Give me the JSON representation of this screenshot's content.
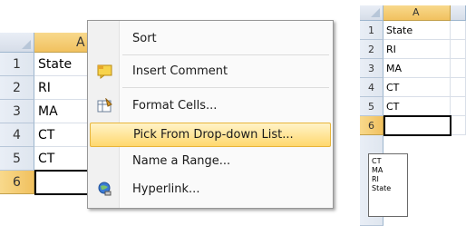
{
  "left_sheet": {
    "column": "A",
    "rows": [
      {
        "num": "1",
        "value": "State"
      },
      {
        "num": "2",
        "value": "RI"
      },
      {
        "num": "3",
        "value": "MA"
      },
      {
        "num": "4",
        "value": "CT"
      },
      {
        "num": "5",
        "value": "CT"
      },
      {
        "num": "6",
        "value": ""
      }
    ]
  },
  "context_menu": {
    "items": [
      {
        "label": "Sort",
        "icon": "none"
      },
      {
        "label": "Insert Comment",
        "icon": "comment-icon"
      },
      {
        "label": "Format Cells...",
        "icon": "format-cells-icon"
      },
      {
        "label": "Pick From Drop-down List...",
        "icon": "none",
        "highlighted": true
      },
      {
        "label": "Name a Range...",
        "icon": "none"
      },
      {
        "label": "Hyperlink...",
        "icon": "hyperlink-icon"
      }
    ]
  },
  "right_sheet": {
    "column": "A",
    "rows": [
      {
        "num": "1",
        "value": "State"
      },
      {
        "num": "2",
        "value": "RI"
      },
      {
        "num": "3",
        "value": "MA"
      },
      {
        "num": "4",
        "value": "CT"
      },
      {
        "num": "5",
        "value": "CT"
      },
      {
        "num": "6",
        "value": ""
      }
    ],
    "dropdown_options": [
      "CT",
      "MA",
      "RI",
      "State"
    ]
  },
  "colors": {
    "selected_header": "#f1c15f",
    "menu_highlight": "#ffd86e",
    "gridline": "#d9dfe8"
  }
}
